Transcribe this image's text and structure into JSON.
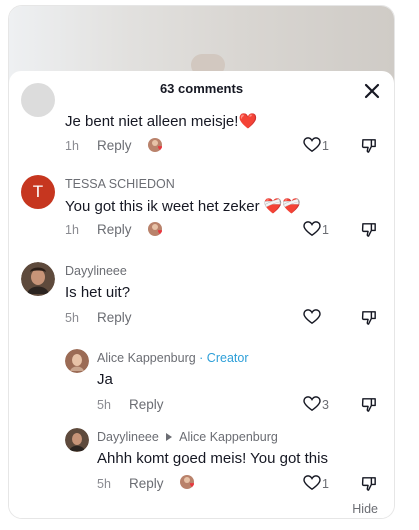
{
  "header": {
    "title": "63 comments"
  },
  "comments": [
    {
      "text": "Je bent niet alleen meisje!❤️",
      "time": "1h",
      "reply": "Reply",
      "likes": "1"
    },
    {
      "initial": "T",
      "username": "TESSA SCHIEDON",
      "text": "You got this ik weet het zeker ❤️‍🩹❤️‍🩹",
      "time": "1h",
      "reply": "Reply",
      "likes": "1"
    },
    {
      "username": "Dayylineee",
      "text": "Is het uit?",
      "time": "5h",
      "reply": "Reply",
      "likes": ""
    },
    {
      "username": "Alice Kappenburg",
      "badge": "· Creator",
      "text": "Ja",
      "time": "5h",
      "reply": "Reply",
      "likes": "3"
    },
    {
      "username": "Dayylineee",
      "reply_to": "Alice Kappenburg",
      "text": "Ahhh komt goed meis! You got this",
      "time": "5h",
      "reply": "Reply",
      "likes": "1"
    }
  ],
  "footer": {
    "hide": "Hide"
  },
  "colors": {
    "avatar_t": "#c6361f",
    "creator": "#2d9fd8",
    "heart_red": "#e8363e"
  }
}
